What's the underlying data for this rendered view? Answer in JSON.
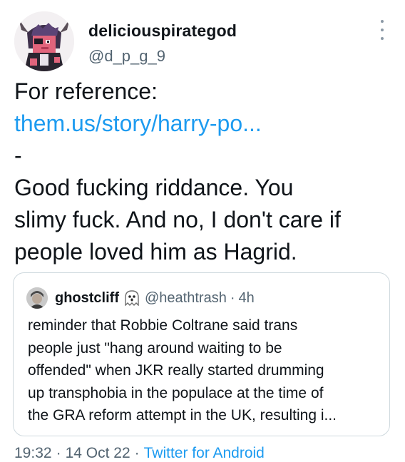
{
  "author": {
    "display_name": "deliciouspirategod",
    "handle": "@d_p_g_9"
  },
  "tweet": {
    "lines": [
      {
        "text": "For reference:",
        "kind": "text"
      },
      {
        "text": "them.us/story/harry-po...",
        "kind": "link"
      },
      {
        "text": "-",
        "kind": "text"
      },
      {
        "text": "Good fucking riddance. You",
        "kind": "text"
      },
      {
        "text": "slimy fuck. And no, I don't care if",
        "kind": "text"
      },
      {
        "text": "people loved him as Hagrid.",
        "kind": "text"
      }
    ]
  },
  "quoted_tweet": {
    "display_name": "ghostcliff",
    "handle": "@heathtrash",
    "separator": "·",
    "time_ago": "4h",
    "lines": [
      "reminder that Robbie Coltrane said trans",
      "people just \"hang around waiting to be",
      "offended\" when JKR really started drumming",
      "up transphobia in the populace at the time of",
      "the GRA reform attempt in the UK, resulting i..."
    ]
  },
  "meta": {
    "time": "19:32",
    "separator": "·",
    "date": "14 Oct 22",
    "source": "Twitter for Android"
  },
  "icons": {
    "more": "more-vertical-icon",
    "ghost": "ghost-emoji-icon"
  },
  "colors": {
    "link": "#1d9bf0",
    "secondary_text": "#536471",
    "primary_text": "#0f1419",
    "border": "#cfd9de"
  }
}
